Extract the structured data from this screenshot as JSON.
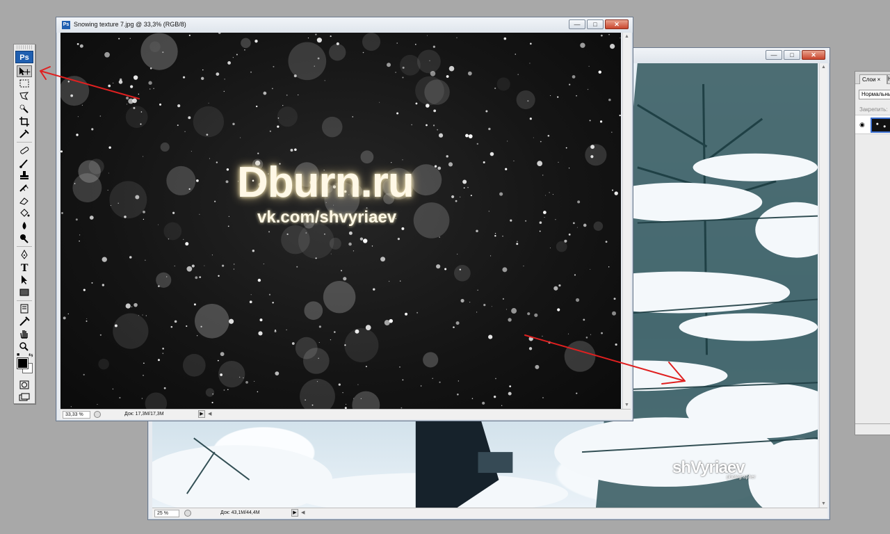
{
  "tools_panel": {
    "logo": "Ps",
    "tools": [
      "move-tool",
      "marquee-tool",
      "lasso-tool",
      "quick-selection-tool",
      "crop-tool",
      "eyedropper-tool",
      "healing-brush-tool",
      "brush-tool",
      "clone-stamp-tool",
      "history-brush-tool",
      "eraser-tool",
      "paint-bucket-tool",
      "blur-tool",
      "dodge-tool",
      "pen-tool",
      "type-tool",
      "path-selection-tool",
      "rectangle-tool",
      "notes-tool",
      "eyedropper-tool",
      "hand-tool",
      "zoom-tool"
    ],
    "foreground_color": "#000000",
    "background_color": "#ffffff"
  },
  "front_window": {
    "title": "Snowing texture 7.jpg @ 33,3% (RGB/8)",
    "canvas_text_main": "Dburn.ru",
    "canvas_text_sub": "vk.com/shvyriaev",
    "zoom": "33,33 %",
    "doc_size": "Док: 17,3M/17,3M"
  },
  "back_window": {
    "title": "",
    "watermark_main": "shVyriaev",
    "watermark_sub": "photographer",
    "zoom": "25 %",
    "doc_size": "Док: 43,1M/44,4M"
  },
  "window_buttons": {
    "minimize": "—",
    "maximize": "□",
    "close": "✕"
  },
  "layers_panel": {
    "tab_label": "Слои ×",
    "tab2_label": "Н",
    "blend_mode": "Нормальный",
    "lock_label": "Закрепить:"
  },
  "colors": {
    "annotation_arrow": "#e02020",
    "ps_blue": "#1f5fb0"
  }
}
